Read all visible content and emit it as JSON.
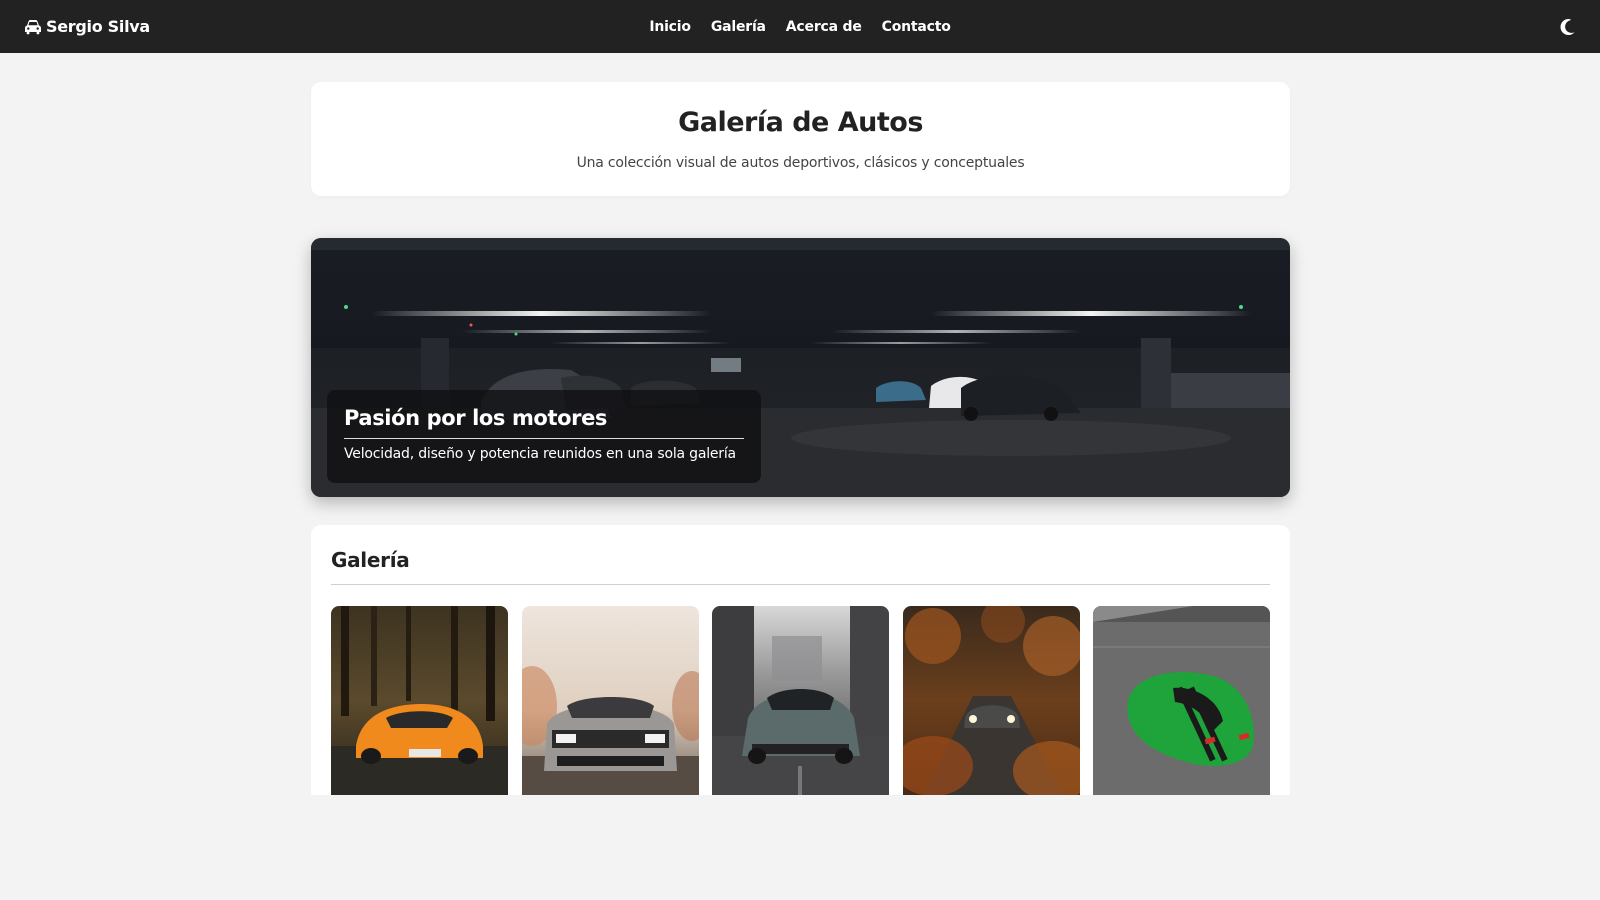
{
  "nav": {
    "brand": "Sergio Silva",
    "brand_icon": "car-icon",
    "links": [
      "Inicio",
      "Galería",
      "Acerca de",
      "Contacto"
    ],
    "theme_icon": "moon-icon"
  },
  "header": {
    "title": "Galería de Autos",
    "subtitle": "Una colección visual de autos deportivos, clásicos y conceptuales"
  },
  "hero": {
    "title": "Pasión por los motores",
    "text": "Velocidad, diseño y potencia reunidos en una sola galería"
  },
  "gallery": {
    "title": "Galería",
    "items": [
      {
        "name": "orange-sports-car-forest"
      },
      {
        "name": "silver-muscle-car"
      },
      {
        "name": "dark-classic-sports-car-street"
      },
      {
        "name": "car-autumn-road"
      },
      {
        "name": "green-muscle-car-top-view"
      }
    ]
  },
  "colors": {
    "navbar": "#222222",
    "page_background": "#f3f3f3",
    "card_background": "#ffffff"
  }
}
